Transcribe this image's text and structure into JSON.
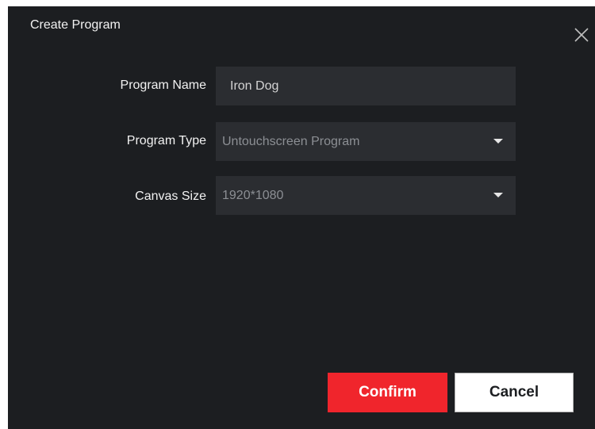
{
  "dialog": {
    "title": "Create Program",
    "close_icon": "close-icon"
  },
  "form": {
    "program_name": {
      "label": "Program Name",
      "value": "Iron Dog"
    },
    "program_type": {
      "label": "Program Type",
      "selected": "Untouchscreen Program",
      "icon": "chevron-down-icon"
    },
    "canvas_size": {
      "label": "Canvas Size",
      "selected": "1920*1080",
      "icon": "chevron-down-icon"
    }
  },
  "buttons": {
    "confirm_label": "Confirm",
    "cancel_label": "Cancel"
  },
  "colors": {
    "dialog_bg": "#1c1e21",
    "field_bg": "#2b2d31",
    "accent": "#f0252c"
  }
}
